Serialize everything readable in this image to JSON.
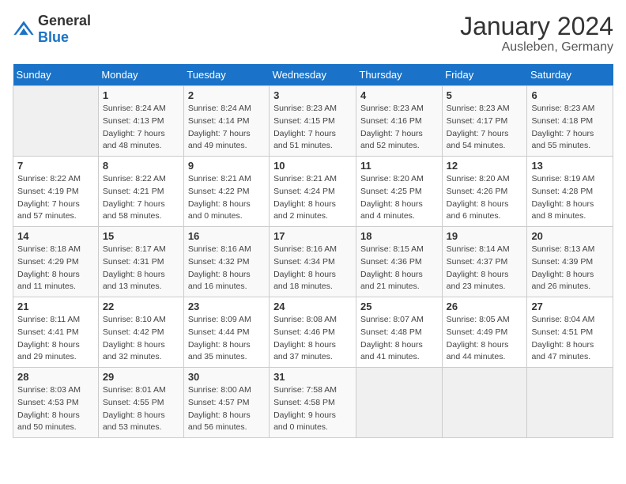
{
  "header": {
    "logo_general": "General",
    "logo_blue": "Blue",
    "title": "January 2024",
    "subtitle": "Ausleben, Germany"
  },
  "calendar": {
    "days_of_week": [
      "Sunday",
      "Monday",
      "Tuesday",
      "Wednesday",
      "Thursday",
      "Friday",
      "Saturday"
    ],
    "weeks": [
      [
        {
          "day": "",
          "sunrise": "",
          "sunset": "",
          "daylight": ""
        },
        {
          "day": "1",
          "sunrise": "Sunrise: 8:24 AM",
          "sunset": "Sunset: 4:13 PM",
          "daylight": "Daylight: 7 hours and 48 minutes."
        },
        {
          "day": "2",
          "sunrise": "Sunrise: 8:24 AM",
          "sunset": "Sunset: 4:14 PM",
          "daylight": "Daylight: 7 hours and 49 minutes."
        },
        {
          "day": "3",
          "sunrise": "Sunrise: 8:23 AM",
          "sunset": "Sunset: 4:15 PM",
          "daylight": "Daylight: 7 hours and 51 minutes."
        },
        {
          "day": "4",
          "sunrise": "Sunrise: 8:23 AM",
          "sunset": "Sunset: 4:16 PM",
          "daylight": "Daylight: 7 hours and 52 minutes."
        },
        {
          "day": "5",
          "sunrise": "Sunrise: 8:23 AM",
          "sunset": "Sunset: 4:17 PM",
          "daylight": "Daylight: 7 hours and 54 minutes."
        },
        {
          "day": "6",
          "sunrise": "Sunrise: 8:23 AM",
          "sunset": "Sunset: 4:18 PM",
          "daylight": "Daylight: 7 hours and 55 minutes."
        }
      ],
      [
        {
          "day": "7",
          "sunrise": "Sunrise: 8:22 AM",
          "sunset": "Sunset: 4:19 PM",
          "daylight": "Daylight: 7 hours and 57 minutes."
        },
        {
          "day": "8",
          "sunrise": "Sunrise: 8:22 AM",
          "sunset": "Sunset: 4:21 PM",
          "daylight": "Daylight: 7 hours and 58 minutes."
        },
        {
          "day": "9",
          "sunrise": "Sunrise: 8:21 AM",
          "sunset": "Sunset: 4:22 PM",
          "daylight": "Daylight: 8 hours and 0 minutes."
        },
        {
          "day": "10",
          "sunrise": "Sunrise: 8:21 AM",
          "sunset": "Sunset: 4:24 PM",
          "daylight": "Daylight: 8 hours and 2 minutes."
        },
        {
          "day": "11",
          "sunrise": "Sunrise: 8:20 AM",
          "sunset": "Sunset: 4:25 PM",
          "daylight": "Daylight: 8 hours and 4 minutes."
        },
        {
          "day": "12",
          "sunrise": "Sunrise: 8:20 AM",
          "sunset": "Sunset: 4:26 PM",
          "daylight": "Daylight: 8 hours and 6 minutes."
        },
        {
          "day": "13",
          "sunrise": "Sunrise: 8:19 AM",
          "sunset": "Sunset: 4:28 PM",
          "daylight": "Daylight: 8 hours and 8 minutes."
        }
      ],
      [
        {
          "day": "14",
          "sunrise": "Sunrise: 8:18 AM",
          "sunset": "Sunset: 4:29 PM",
          "daylight": "Daylight: 8 hours and 11 minutes."
        },
        {
          "day": "15",
          "sunrise": "Sunrise: 8:17 AM",
          "sunset": "Sunset: 4:31 PM",
          "daylight": "Daylight: 8 hours and 13 minutes."
        },
        {
          "day": "16",
          "sunrise": "Sunrise: 8:16 AM",
          "sunset": "Sunset: 4:32 PM",
          "daylight": "Daylight: 8 hours and 16 minutes."
        },
        {
          "day": "17",
          "sunrise": "Sunrise: 8:16 AM",
          "sunset": "Sunset: 4:34 PM",
          "daylight": "Daylight: 8 hours and 18 minutes."
        },
        {
          "day": "18",
          "sunrise": "Sunrise: 8:15 AM",
          "sunset": "Sunset: 4:36 PM",
          "daylight": "Daylight: 8 hours and 21 minutes."
        },
        {
          "day": "19",
          "sunrise": "Sunrise: 8:14 AM",
          "sunset": "Sunset: 4:37 PM",
          "daylight": "Daylight: 8 hours and 23 minutes."
        },
        {
          "day": "20",
          "sunrise": "Sunrise: 8:13 AM",
          "sunset": "Sunset: 4:39 PM",
          "daylight": "Daylight: 8 hours and 26 minutes."
        }
      ],
      [
        {
          "day": "21",
          "sunrise": "Sunrise: 8:11 AM",
          "sunset": "Sunset: 4:41 PM",
          "daylight": "Daylight: 8 hours and 29 minutes."
        },
        {
          "day": "22",
          "sunrise": "Sunrise: 8:10 AM",
          "sunset": "Sunset: 4:42 PM",
          "daylight": "Daylight: 8 hours and 32 minutes."
        },
        {
          "day": "23",
          "sunrise": "Sunrise: 8:09 AM",
          "sunset": "Sunset: 4:44 PM",
          "daylight": "Daylight: 8 hours and 35 minutes."
        },
        {
          "day": "24",
          "sunrise": "Sunrise: 8:08 AM",
          "sunset": "Sunset: 4:46 PM",
          "daylight": "Daylight: 8 hours and 37 minutes."
        },
        {
          "day": "25",
          "sunrise": "Sunrise: 8:07 AM",
          "sunset": "Sunset: 4:48 PM",
          "daylight": "Daylight: 8 hours and 41 minutes."
        },
        {
          "day": "26",
          "sunrise": "Sunrise: 8:05 AM",
          "sunset": "Sunset: 4:49 PM",
          "daylight": "Daylight: 8 hours and 44 minutes."
        },
        {
          "day": "27",
          "sunrise": "Sunrise: 8:04 AM",
          "sunset": "Sunset: 4:51 PM",
          "daylight": "Daylight: 8 hours and 47 minutes."
        }
      ],
      [
        {
          "day": "28",
          "sunrise": "Sunrise: 8:03 AM",
          "sunset": "Sunset: 4:53 PM",
          "daylight": "Daylight: 8 hours and 50 minutes."
        },
        {
          "day": "29",
          "sunrise": "Sunrise: 8:01 AM",
          "sunset": "Sunset: 4:55 PM",
          "daylight": "Daylight: 8 hours and 53 minutes."
        },
        {
          "day": "30",
          "sunrise": "Sunrise: 8:00 AM",
          "sunset": "Sunset: 4:57 PM",
          "daylight": "Daylight: 8 hours and 56 minutes."
        },
        {
          "day": "31",
          "sunrise": "Sunrise: 7:58 AM",
          "sunset": "Sunset: 4:58 PM",
          "daylight": "Daylight: 9 hours and 0 minutes."
        },
        {
          "day": "",
          "sunrise": "",
          "sunset": "",
          "daylight": ""
        },
        {
          "day": "",
          "sunrise": "",
          "sunset": "",
          "daylight": ""
        },
        {
          "day": "",
          "sunrise": "",
          "sunset": "",
          "daylight": ""
        }
      ]
    ]
  }
}
